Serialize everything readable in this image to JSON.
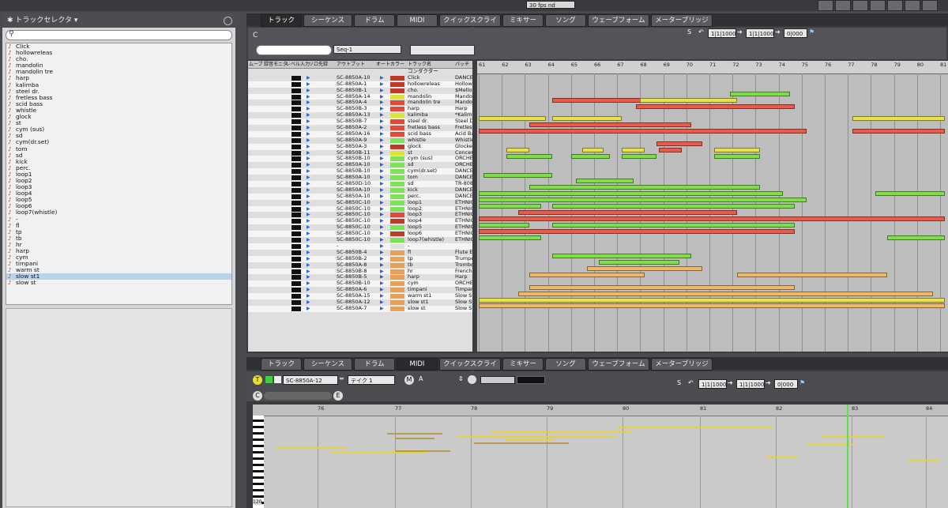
{
  "top": {
    "fps_label": "30 fps nd"
  },
  "track_selector": {
    "title": "トラックセレクタ ▾",
    "items": [
      "Click",
      "hollowreleas",
      "cho.",
      "mandolin",
      "mandolin tre",
      "harp",
      "kalimba",
      "steel dr.",
      "fretless bass",
      "scid bass",
      "whistle",
      "glock",
      "st",
      "cym (sus)",
      "sd",
      "cym(dr.set)",
      "tom",
      "sd",
      "kick",
      "perc.",
      "loop1",
      "loop2",
      "loop3",
      "loop4",
      "loop5",
      "loop6",
      "loop7(whistle)",
      "-",
      "fl",
      "tp",
      "tb",
      "hr",
      "harp",
      "cym",
      "timpani",
      "warm st",
      "slow st1",
      "slow st"
    ],
    "selected_index": 36
  },
  "main_tabs": [
    "トラック",
    "シーケンス",
    "ドラム",
    "MIDI",
    "クイックスクライブ",
    "ミキサー",
    "ソング",
    "ウェーブフォーム",
    "メーターブリッジ"
  ],
  "main_active_tab": 0,
  "sequence_bar": {
    "c_label": "C",
    "sequence_name": "Seq-1",
    "s_label": "S",
    "position1": "1|1|1000",
    "position2": "1|1|1000",
    "position3": "0|000"
  },
  "columns": {
    "mute": "ムーブ",
    "rec": "録音",
    "mon": "モニタ",
    "level": "レベル",
    "input": "入力",
    "solo": "ソロ先録",
    "output": "アウトプット",
    "auto": "オート",
    "color": "カラー",
    "name": "トラック名",
    "patch": "パッチ"
  },
  "tracks": [
    {
      "port": "SC-8850A-10",
      "color": "#c0392b",
      "name": "Click",
      "patch": "DANCE"
    },
    {
      "port": "SC-8850A-1",
      "color": "#c0392b",
      "name": "hollowreleas",
      "patch": "Hollow"
    },
    {
      "port": "SC-8850B-1",
      "color": "#c0392b",
      "name": "cho.",
      "patch": "$Mello"
    },
    {
      "port": "SC-8850A-14",
      "color": "#d9e436",
      "name": "mandolin",
      "patch": "Mando"
    },
    {
      "port": "SC-8850A-4",
      "color": "#e04a3a",
      "name": "mandolin tre",
      "patch": "Mando"
    },
    {
      "port": "SC-8850B-3",
      "color": "#e04a3a",
      "name": "harp",
      "patch": "Harp"
    },
    {
      "port": "SC-8850A-13",
      "color": "#d9e436",
      "name": "kalimba",
      "patch": "*Kalim"
    },
    {
      "port": "SC-8850B-7",
      "color": "#e04a3a",
      "name": "steel dr.",
      "patch": "Steel D"
    },
    {
      "port": "SC-8850A-2",
      "color": "#e04a3a",
      "name": "fretless bass",
      "patch": "Fretles"
    },
    {
      "port": "SC-8850A-16",
      "color": "#e04a3a",
      "name": "scid bass",
      "patch": "Acid Ba"
    },
    {
      "port": "SC-8850A-9",
      "color": "#7fe05a",
      "name": "whistle",
      "patch": "Whistle"
    },
    {
      "port": "SC-8850A-3",
      "color": "#c0392b",
      "name": "glock",
      "patch": "Glocke"
    },
    {
      "port": "SC-8850B-11",
      "color": "#d9e436",
      "name": "st",
      "patch": "Concer"
    },
    {
      "port": "SC-8850B-10",
      "color": "#7fe05a",
      "name": "cym (sus)",
      "patch": "ORCHE"
    },
    {
      "port": "SC-8850A-10",
      "color": "#7fe05a",
      "name": "sd",
      "patch": "ORCHE"
    },
    {
      "port": "SC-8850B-10",
      "color": "#7fe05a",
      "name": "cym(dr.set)",
      "patch": "DANCE"
    },
    {
      "port": "SC-8850A-10",
      "color": "#7fe05a",
      "name": "tom",
      "patch": "DANCE"
    },
    {
      "port": "SC-8850D-10",
      "color": "#7fe05a",
      "name": "sd",
      "patch": "TR-808"
    },
    {
      "port": "SC-8850A-10",
      "color": "#7fe05a",
      "name": "kick",
      "patch": "DANCE"
    },
    {
      "port": "SC-8850A-10",
      "color": "#7fe05a",
      "name": "perc.",
      "patch": "DANCE"
    },
    {
      "port": "SC-8850C-10",
      "color": "#7fe05a",
      "name": "loop1",
      "patch": "ETHNIC"
    },
    {
      "port": "SC-8850C-10",
      "color": "#7fe05a",
      "name": "loop2",
      "patch": "ETHNIC"
    },
    {
      "port": "SC-8850C-10",
      "color": "#e04a3a",
      "name": "loop3",
      "patch": "ETHNIC"
    },
    {
      "port": "SC-8850C-10",
      "color": "#c0392b",
      "name": "loop4",
      "patch": "ETHNIC"
    },
    {
      "port": "SC-8850C-10",
      "color": "#7fe05a",
      "name": "loop5",
      "patch": "ETHNIC"
    },
    {
      "port": "SC-8850C-10",
      "color": "#c0392b",
      "name": "loop6",
      "patch": "ETHNIC"
    },
    {
      "port": "SC-8850C-10",
      "color": "#7fe05a",
      "name": "loop7(whistle)",
      "patch": "ETHNIC"
    },
    {
      "port": "-",
      "color": "#dfdfdf",
      "name": "-",
      "patch": ""
    },
    {
      "port": "SC-8850B-4",
      "color": "#e6a05a",
      "name": "fl",
      "patch": "Flute E"
    },
    {
      "port": "SC-8850B-2",
      "color": "#e6a05a",
      "name": "tp",
      "patch": "Trumpe"
    },
    {
      "port": "SC-8850A-8",
      "color": "#e6a05a",
      "name": "tb",
      "patch": "Trombo"
    },
    {
      "port": "SC-8850B-8",
      "color": "#e6a05a",
      "name": "hr",
      "patch": "French"
    },
    {
      "port": "SC-8850B-5",
      "color": "#e6a05a",
      "name": "harp",
      "patch": "Harp"
    },
    {
      "port": "SC-8850B-10",
      "color": "#e6a05a",
      "name": "cym",
      "patch": "ORCHE"
    },
    {
      "port": "SC-8850A-6",
      "color": "#e6a05a",
      "name": "timpani",
      "patch": "Timpan"
    },
    {
      "port": "SC-8850A-15",
      "color": "#e6a05a",
      "name": "warm st1",
      "patch": "Slow St"
    },
    {
      "port": "SC-8850A-12",
      "color": "#e6a05a",
      "name": "slow st1",
      "patch": "Slow St"
    },
    {
      "port": "SC-8850A-7",
      "color": "#e6a05a",
      "name": "slow st",
      "patch": "Slow St"
    }
  ],
  "track_header_label": "コンダクター",
  "ruler_bars": [
    "61",
    "62",
    "63",
    "64",
    "65",
    "66",
    "67",
    "68",
    "69",
    "70",
    "71",
    "72",
    "73",
    "74",
    "75",
    "76",
    "77",
    "78",
    "79",
    "80",
    "81"
  ],
  "clip_colors": {
    "red": "#e85a4a",
    "yellow": "#e8e24a",
    "green": "#7fdc4a",
    "orange": "#f0b86a"
  },
  "clips": [
    {
      "row": 2,
      "bar_start": 71.7,
      "bar_end": 74.3,
      "c": "green"
    },
    {
      "row": 3,
      "bar_start": 64.0,
      "bar_end": 68.0,
      "c": "red"
    },
    {
      "row": 3,
      "bar_start": 67.8,
      "bar_end": 72.0,
      "c": "yellow"
    },
    {
      "row": 4,
      "bar_start": 67.6,
      "bar_end": 74.5,
      "c": "red"
    },
    {
      "row": 6,
      "bar_start": 60.8,
      "bar_end": 63.7,
      "c": "yellow"
    },
    {
      "row": 6,
      "bar_start": 64.0,
      "bar_end": 67.0,
      "c": "yellow"
    },
    {
      "row": 6,
      "bar_start": 77.0,
      "bar_end": 81.0,
      "c": "yellow"
    },
    {
      "row": 7,
      "bar_start": 63.0,
      "bar_end": 70.0,
      "c": "red"
    },
    {
      "row": 8,
      "bar_start": 60.8,
      "bar_end": 75.0,
      "c": "red"
    },
    {
      "row": 8,
      "bar_start": 77.0,
      "bar_end": 81.0,
      "c": "red"
    },
    {
      "row": 10,
      "bar_start": 68.5,
      "bar_end": 70.5,
      "c": "red"
    },
    {
      "row": 11,
      "bar_start": 62.0,
      "bar_end": 63.0,
      "c": "yellow"
    },
    {
      "row": 11,
      "bar_start": 65.3,
      "bar_end": 66.2,
      "c": "yellow"
    },
    {
      "row": 11,
      "bar_start": 67.0,
      "bar_end": 68.0,
      "c": "yellow"
    },
    {
      "row": 11,
      "bar_start": 68.6,
      "bar_end": 69.6,
      "c": "red"
    },
    {
      "row": 11,
      "bar_start": 71.0,
      "bar_end": 73.0,
      "c": "yellow"
    },
    {
      "row": 12,
      "bar_start": 62.0,
      "bar_end": 64.0,
      "c": "green"
    },
    {
      "row": 12,
      "bar_start": 64.8,
      "bar_end": 66.5,
      "c": "green"
    },
    {
      "row": 12,
      "bar_start": 67.0,
      "bar_end": 68.5,
      "c": "green"
    },
    {
      "row": 12,
      "bar_start": 71.0,
      "bar_end": 73.0,
      "c": "green"
    },
    {
      "row": 15,
      "bar_start": 61.0,
      "bar_end": 64.0,
      "c": "green"
    },
    {
      "row": 16,
      "bar_start": 65.0,
      "bar_end": 67.5,
      "c": "green"
    },
    {
      "row": 17,
      "bar_start": 63.0,
      "bar_end": 73.0,
      "c": "green"
    },
    {
      "row": 18,
      "bar_start": 60.8,
      "bar_end": 74.0,
      "c": "green"
    },
    {
      "row": 18,
      "bar_start": 78.0,
      "bar_end": 81.0,
      "c": "green"
    },
    {
      "row": 19,
      "bar_start": 60.8,
      "bar_end": 75.0,
      "c": "green"
    },
    {
      "row": 20,
      "bar_start": 60.8,
      "bar_end": 63.5,
      "c": "green"
    },
    {
      "row": 20,
      "bar_start": 64.0,
      "bar_end": 74.5,
      "c": "green"
    },
    {
      "row": 21,
      "bar_start": 62.5,
      "bar_end": 72.0,
      "c": "red"
    },
    {
      "row": 22,
      "bar_start": 60.8,
      "bar_end": 81.0,
      "c": "red"
    },
    {
      "row": 23,
      "bar_start": 60.8,
      "bar_end": 63.0,
      "c": "green"
    },
    {
      "row": 23,
      "bar_start": 64.0,
      "bar_end": 74.5,
      "c": "green"
    },
    {
      "row": 24,
      "bar_start": 60.8,
      "bar_end": 74.5,
      "c": "red"
    },
    {
      "row": 25,
      "bar_start": 60.8,
      "bar_end": 63.5,
      "c": "green"
    },
    {
      "row": 25,
      "bar_start": 78.5,
      "bar_end": 81.0,
      "c": "green"
    },
    {
      "row": 28,
      "bar_start": 64.0,
      "bar_end": 70.0,
      "c": "green"
    },
    {
      "row": 29,
      "bar_start": 66.0,
      "bar_end": 69.5,
      "c": "green"
    },
    {
      "row": 30,
      "bar_start": 65.5,
      "bar_end": 70.5,
      "c": "orange"
    },
    {
      "row": 31,
      "bar_start": 63.0,
      "bar_end": 68.0,
      "c": "orange"
    },
    {
      "row": 31,
      "bar_start": 72.0,
      "bar_end": 78.5,
      "c": "orange"
    },
    {
      "row": 33,
      "bar_start": 63.0,
      "bar_end": 74.5,
      "c": "orange"
    },
    {
      "row": 34,
      "bar_start": 62.5,
      "bar_end": 80.5,
      "c": "orange"
    },
    {
      "row": 35,
      "bar_start": 60.8,
      "bar_end": 81.0,
      "c": "yellow"
    },
    {
      "row": 36,
      "bar_start": 60.8,
      "bar_end": 81.0,
      "c": "orange"
    }
  ],
  "midi_tabs": [
    "トラック",
    "シーケンス",
    "ドラム",
    "MIDI",
    "クイックスクライブ",
    "ミキサー",
    "ソング",
    "ウェーブフォーム",
    "メーターブリッジ"
  ],
  "midi_active_tab": 3,
  "midi_toolbar": {
    "t_label": "T",
    "port": "SC-8850A-12",
    "take": "テイク 1",
    "m_label": "M",
    "a_label": "A",
    "c_label": "C",
    "e_label": "E",
    "s_label": "S",
    "pos1": "1|1|1000",
    "pos2": "1|1|1000",
    "pos3": "0|000"
  },
  "midi_ruler": [
    "76",
    "77",
    "78",
    "79",
    "80",
    "81",
    "82",
    "83",
    "84"
  ],
  "key_label": "120"
}
